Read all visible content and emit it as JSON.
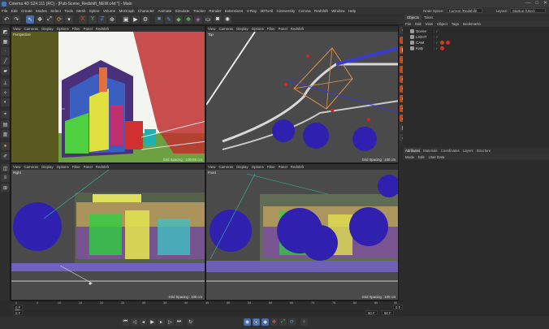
{
  "window": {
    "title": "Cinema 4D S24.111 (RC) - [Pub-Scene_Redshift_NEW.c4d *] - Main",
    "controls": [
      "—",
      "□",
      "✕"
    ]
  },
  "menubar": {
    "items": [
      "File",
      "Edit",
      "Create",
      "Modes",
      "Select",
      "Tools",
      "Mesh",
      "Spline",
      "Volume",
      "MoGraph",
      "Character",
      "Animate",
      "Simulate",
      "Tracker",
      "Render",
      "Extensions",
      "V-Ray",
      "3DToAll",
      "Cineversity",
      "Corona",
      "Redshift",
      "Window",
      "Help"
    ],
    "node_space_label": "Node Space:",
    "node_space_value": "Current (Redshift)",
    "layout_label": "Layout:",
    "layout_value": "Startup (User)"
  },
  "toolbar": {
    "icons": [
      "undo-icon",
      "redo-icon",
      "select-icon",
      "move-icon",
      "scale-icon",
      "rotate-icon",
      "recent-icon",
      "axis-x-icon",
      "axis-y-icon",
      "axis-z-icon",
      "coord-icon",
      "render-view-icon",
      "render-icon",
      "render-settings-icon",
      "cube-icon",
      "pen-icon",
      "subdivision-icon",
      "cloner-icon",
      "deformer-icon",
      "floor-icon",
      "camera-icon",
      "light-icon"
    ]
  },
  "viewports": [
    {
      "name": "Perspective",
      "menu": [
        "View",
        "Cameras",
        "Display",
        "Options",
        "Filter",
        "Panel",
        "Redshift"
      ],
      "grid": "Grid Spacing : 100000 cm"
    },
    {
      "name": "Top",
      "menu": [
        "View",
        "Cameras",
        "Display",
        "Options",
        "Filter",
        "Panel",
        "Redshift"
      ],
      "grid": "Grid Spacing : 100 cm"
    },
    {
      "name": "Right",
      "menu": [
        "View",
        "Cameras",
        "Display",
        "Options",
        "Filter",
        "Panel",
        "Redshift"
      ],
      "grid": "Grid Spacing : 100 cm"
    },
    {
      "name": "Front",
      "menu": [
        "View",
        "Cameras",
        "Display",
        "Options",
        "Filter",
        "Panel",
        "Redshift"
      ],
      "grid": "Grid Spacing : 100 cm"
    }
  ],
  "object_manager": {
    "tabs": [
      "Objects",
      "Takes"
    ],
    "menu": [
      "File",
      "Edit",
      "View",
      "Object",
      "Tags",
      "Bookmarks"
    ],
    "objects": [
      {
        "name": "Scene",
        "color": "#9a9a9a"
      },
      {
        "name": "LIGHT",
        "color": "#9a9a9a"
      },
      {
        "name": "CAM",
        "color": "#9a9a9a"
      },
      {
        "name": "Katy",
        "color": "#9a9a9a"
      }
    ]
  },
  "attribute_manager": {
    "tabs": [
      "Attributes",
      "Materials",
      "Coordinates",
      "Layers",
      "Structure"
    ],
    "menu": [
      "Mode",
      "Edit",
      "User Data"
    ]
  },
  "timeline": {
    "ticks": [
      "0",
      "5",
      "10",
      "15",
      "20",
      "25",
      "30",
      "35",
      "40",
      "45",
      "50",
      "55",
      "60",
      "65",
      "70",
      "75",
      "80",
      "85",
      "90"
    ],
    "current_frame": "0 F",
    "start_frame": "0 F",
    "end_frame": "90 F",
    "end_frame_2": "90 F",
    "right_frame": "0 F"
  },
  "colors": {
    "accent": "#5b8fd1",
    "record": "#d94a3a"
  }
}
